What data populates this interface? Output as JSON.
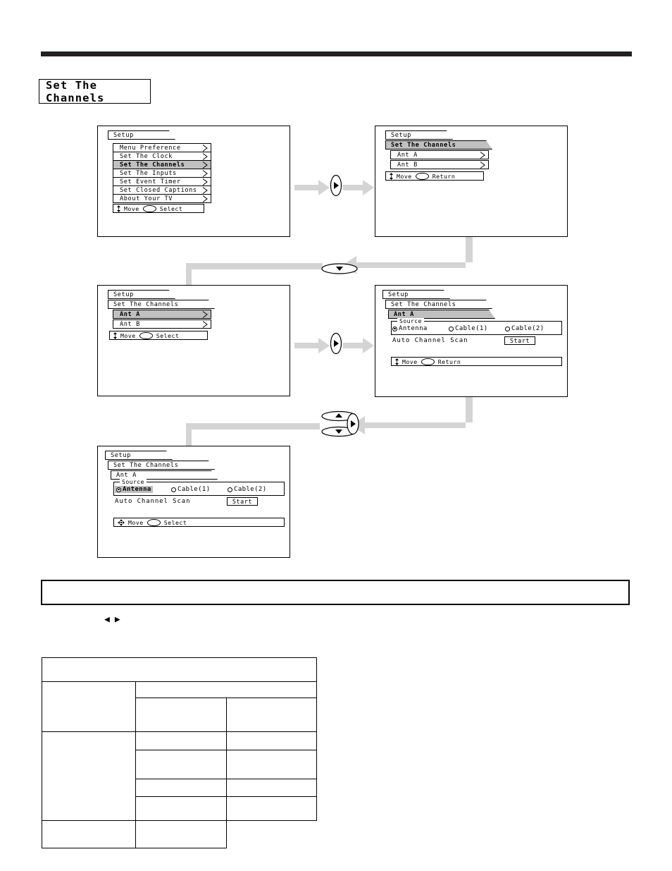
{
  "page": {
    "title": "Set The Channels"
  },
  "panels": {
    "step1": {
      "name": "setup-main-menu",
      "tab": "Setup",
      "items": [
        "Menu Preference",
        "Set The Clock",
        "Set The Channels",
        "Set The Inputs",
        "Set Event Timer",
        "Set Closed Captions",
        "About Your TV"
      ],
      "selected_index": 2,
      "hint": {
        "move": "Move",
        "action": "Select"
      }
    },
    "step2": {
      "name": "set-the-channels-menu",
      "tab": "Setup",
      "breadcrumb": "Set The Channels",
      "items": [
        "Ant A",
        "Ant B"
      ],
      "selected_index": -1,
      "hint": {
        "move": "Move",
        "action": "Return"
      }
    },
    "step3": {
      "name": "ant-a-selected-menu",
      "tab": "Setup",
      "breadcrumb": "Set The Channels",
      "items": [
        "Ant A",
        "Ant B"
      ],
      "selected_index": 0,
      "hint": {
        "move": "Move",
        "action": "Select"
      }
    },
    "step4": {
      "name": "ant-a-source-panel",
      "tab": "Setup",
      "breadcrumb": "Set The Channels",
      "subcrumb": "Ant A",
      "source_legend": "Source",
      "options": [
        "Antenna",
        "Cable(1)",
        "Cable(2)"
      ],
      "selected_option": 0,
      "highlighted_option": -1,
      "scan_label": "Auto Channel Scan",
      "scan_button": "Start",
      "hint": {
        "move": "Move",
        "action": "Return"
      }
    },
    "step5": {
      "name": "ant-a-source-focused-panel",
      "tab": "Setup",
      "breadcrumb": "Set The Channels",
      "subcrumb": "Ant A",
      "source_legend": "Source",
      "options": [
        "Antenna",
        "Cable(1)",
        "Cable(2)"
      ],
      "selected_option": 0,
      "highlighted_option": 0,
      "scan_label": "Auto Channel Scan",
      "scan_button": "Start",
      "hint": {
        "move": "Move",
        "action": "Select"
      }
    }
  },
  "connectors": {
    "right_arrow_icon": "right-triangle-button",
    "down_arrow_icon": "down-triangle-button",
    "navpad_icon": "up-down-right-navpad"
  },
  "note_box": {
    "text": ""
  },
  "direction_glyphs": {
    "left": "◀",
    "right": "▶"
  },
  "table": {
    "header": [
      ""
    ],
    "rows": [
      [
        "",
        "",
        ""
      ],
      [
        "",
        "",
        ""
      ],
      [
        "",
        "",
        ""
      ],
      [
        "",
        "",
        ""
      ],
      [
        "",
        "",
        ""
      ],
      [
        "",
        "",
        ""
      ]
    ]
  },
  "colors": {
    "rule": "#231f20",
    "highlight": "#c0c0c0",
    "connector": "#d4d4d4"
  }
}
